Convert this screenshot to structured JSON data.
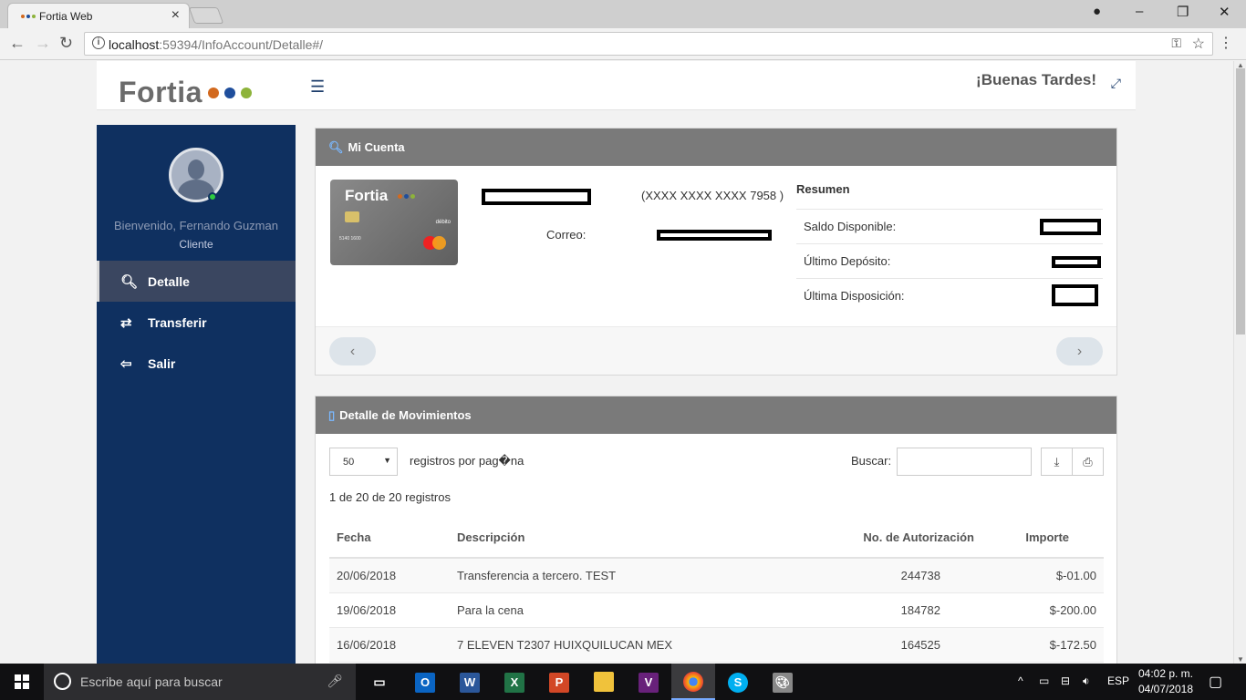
{
  "browser": {
    "tab_title": "Fortia Web",
    "url_host": "localhost",
    "url_path": ":59394/InfoAccount/Detalle#/"
  },
  "header": {
    "logo_text": "Fortia",
    "logo_colors": [
      "#d2691e",
      "#1f4e9c",
      "#8db33a"
    ],
    "greeting": "¡Buenas Tardes!"
  },
  "sidebar": {
    "welcome": "Bienvenido, Fernando Guzman",
    "role": "Cliente",
    "items": [
      {
        "label": "Detalle",
        "icon": "search-icon"
      },
      {
        "label": "Transferir",
        "icon": "transfer-icon"
      },
      {
        "label": "Salir",
        "icon": "logout-icon"
      }
    ]
  },
  "account_panel": {
    "title": "Mi Cuenta",
    "card_brand": "Fortia",
    "card_type": "débito",
    "card_number_text": "5140 1600",
    "card_mask": "(XXXX XXXX XXXX 7958 )",
    "email_label": "Correo:",
    "summary_title": "Resumen",
    "summary": [
      {
        "label": "Saldo Disponible:"
      },
      {
        "label": "Último Depósito:"
      },
      {
        "label": "Última Disposición:"
      }
    ],
    "prev": "‹",
    "next": "›"
  },
  "movements_panel": {
    "title": "Detalle de Movimientos",
    "page_length": "50",
    "page_length_suffix": "registros por pag�na",
    "search_label": "Buscar:",
    "info": "1 de 20 de 20 registros",
    "columns": [
      "Fecha",
      "Descripción",
      "No. de Autorización",
      "Importe"
    ],
    "rows": [
      {
        "fecha": "20/06/2018",
        "descripcion": "Transferencia a tercero. TEST",
        "autorizacion": "244738",
        "importe": "$-01.00"
      },
      {
        "fecha": "19/06/2018",
        "descripcion": "Para la cena",
        "autorizacion": "184782",
        "importe": "$-200.00"
      },
      {
        "fecha": "16/06/2018",
        "descripcion": "7 ELEVEN T2307 HUIXQUILUCAN MEX",
        "autorizacion": "164525",
        "importe": "$-172.50"
      }
    ]
  },
  "taskbar": {
    "search_placeholder": "Escribe aquí para buscar",
    "lang": "ESP",
    "time": "04:02 p. m.",
    "date": "04/07/2018"
  }
}
